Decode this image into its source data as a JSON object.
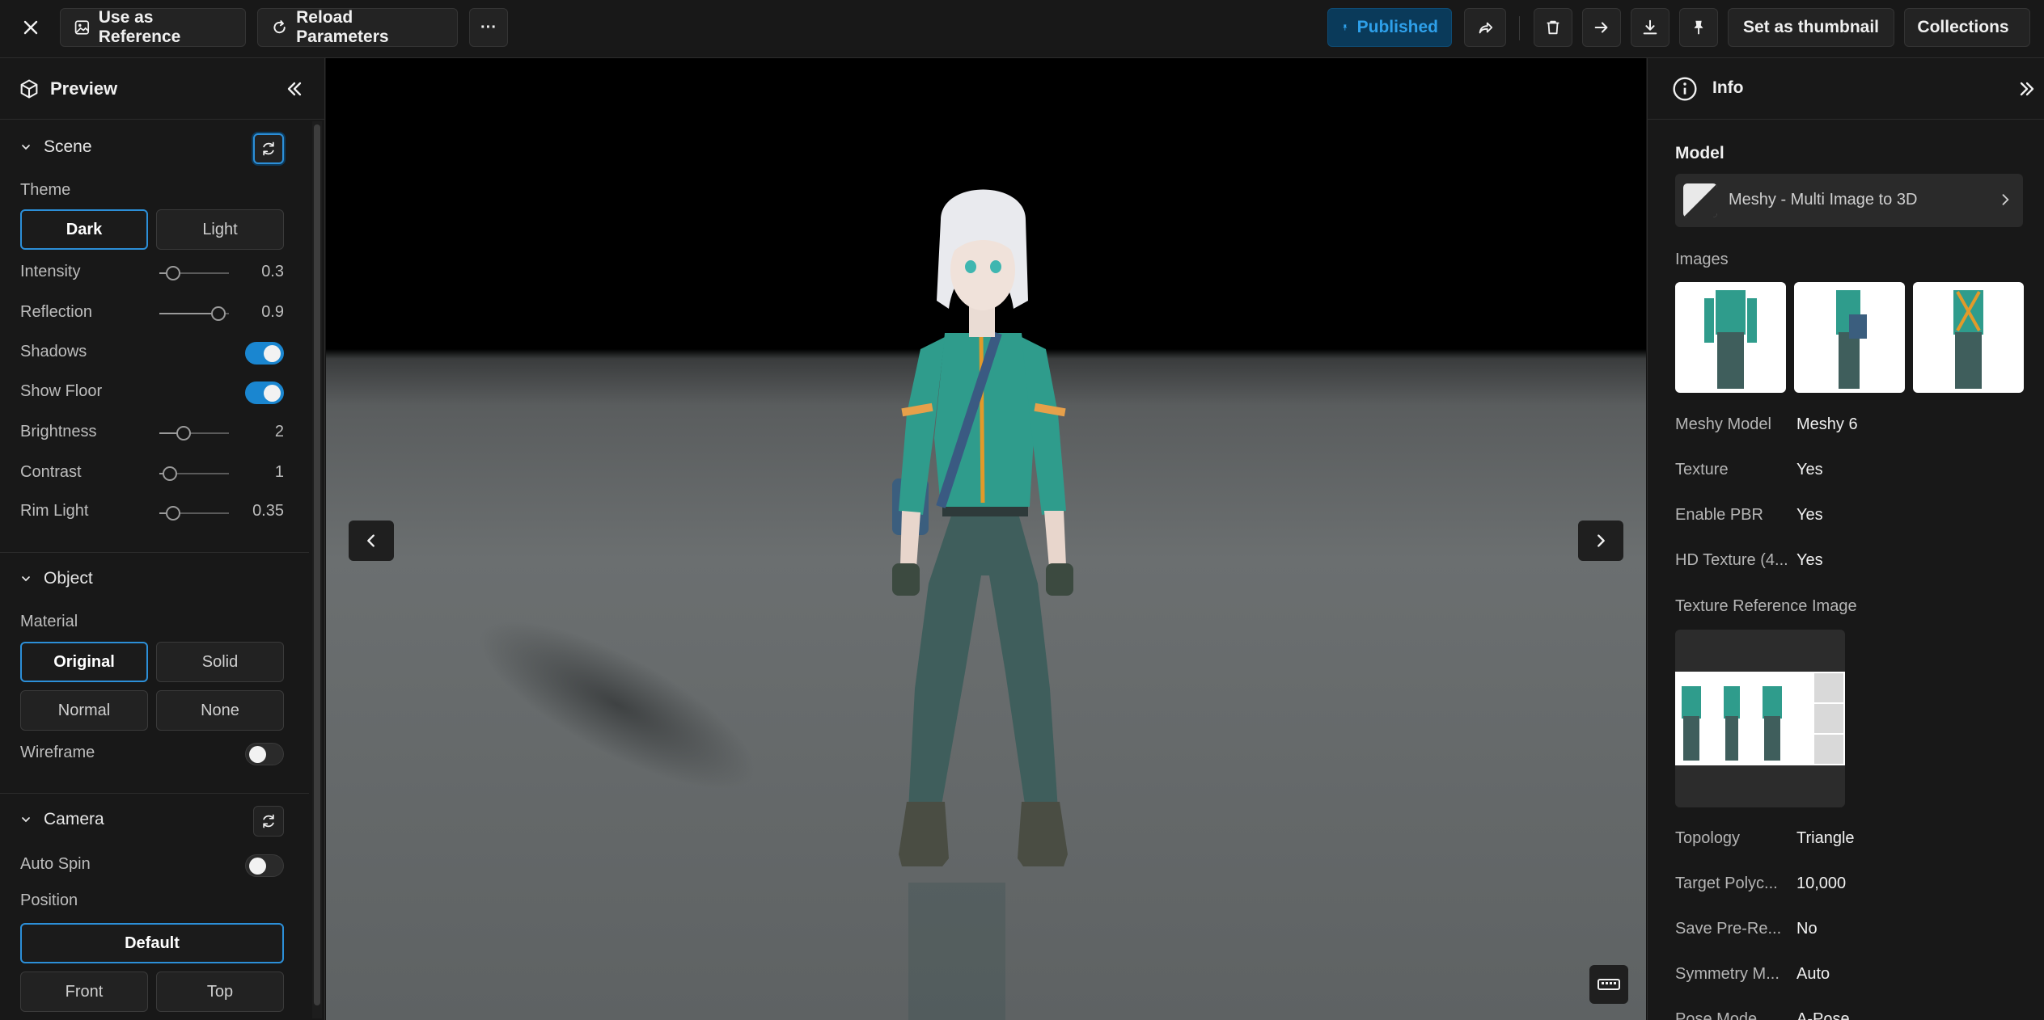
{
  "toolbar": {
    "close_icon": "close-icon",
    "use_as_reference": "Use as Reference",
    "reload_parameters": "Reload Parameters",
    "more": "···",
    "published": "Published",
    "set_as_thumbnail": "Set as thumbnail",
    "collections": "Collections",
    "accent_color": "#2ea0ea"
  },
  "left_panel": {
    "title": "Preview",
    "scene": {
      "title": "Scene",
      "theme_label": "Theme",
      "theme_options": [
        "Dark",
        "Light"
      ],
      "theme_selected": "Dark",
      "intensity": {
        "label": "Intensity",
        "value": "0.3",
        "fraction": 0.2
      },
      "reflection": {
        "label": "Reflection",
        "value": "0.9",
        "fraction": 0.85
      },
      "shadows": {
        "label": "Shadows",
        "on": true
      },
      "show_floor": {
        "label": "Show Floor",
        "on": true
      },
      "brightness": {
        "label": "Brightness",
        "value": "2",
        "fraction": 0.35
      },
      "contrast": {
        "label": "Contrast",
        "value": "1",
        "fraction": 0.15
      },
      "rim_light": {
        "label": "Rim Light",
        "value": "0.35",
        "fraction": 0.2
      }
    },
    "object": {
      "title": "Object",
      "material_label": "Material",
      "material_options": [
        "Original",
        "Solid",
        "Normal",
        "None"
      ],
      "material_selected": "Original",
      "wireframe": {
        "label": "Wireframe",
        "on": false
      }
    },
    "camera": {
      "title": "Camera",
      "auto_spin": {
        "label": "Auto Spin",
        "on": false
      },
      "position_label": "Position",
      "position_default": "Default",
      "position_options": [
        "Front",
        "Top"
      ]
    }
  },
  "right_panel": {
    "title": "Info",
    "model_label": "Model",
    "model_name": "Meshy - Multi Image to 3D",
    "images_label": "Images",
    "fields": [
      {
        "label": "Meshy Model",
        "value": "Meshy 6"
      },
      {
        "label": "Texture",
        "value": "Yes"
      },
      {
        "label": "Enable PBR",
        "value": "Yes"
      },
      {
        "label": "HD Texture (4...",
        "value": "Yes"
      }
    ],
    "texture_reference_label": "Texture Reference Image",
    "fields2": [
      {
        "label": "Topology",
        "value": "Triangle"
      },
      {
        "label": "Target Polyc...",
        "value": "10,000"
      },
      {
        "label": "Save Pre-Re...",
        "value": "No"
      },
      {
        "label": "Symmetry M...",
        "value": "Auto"
      },
      {
        "label": "Pose Mode",
        "value": "A-Pose"
      }
    ]
  }
}
